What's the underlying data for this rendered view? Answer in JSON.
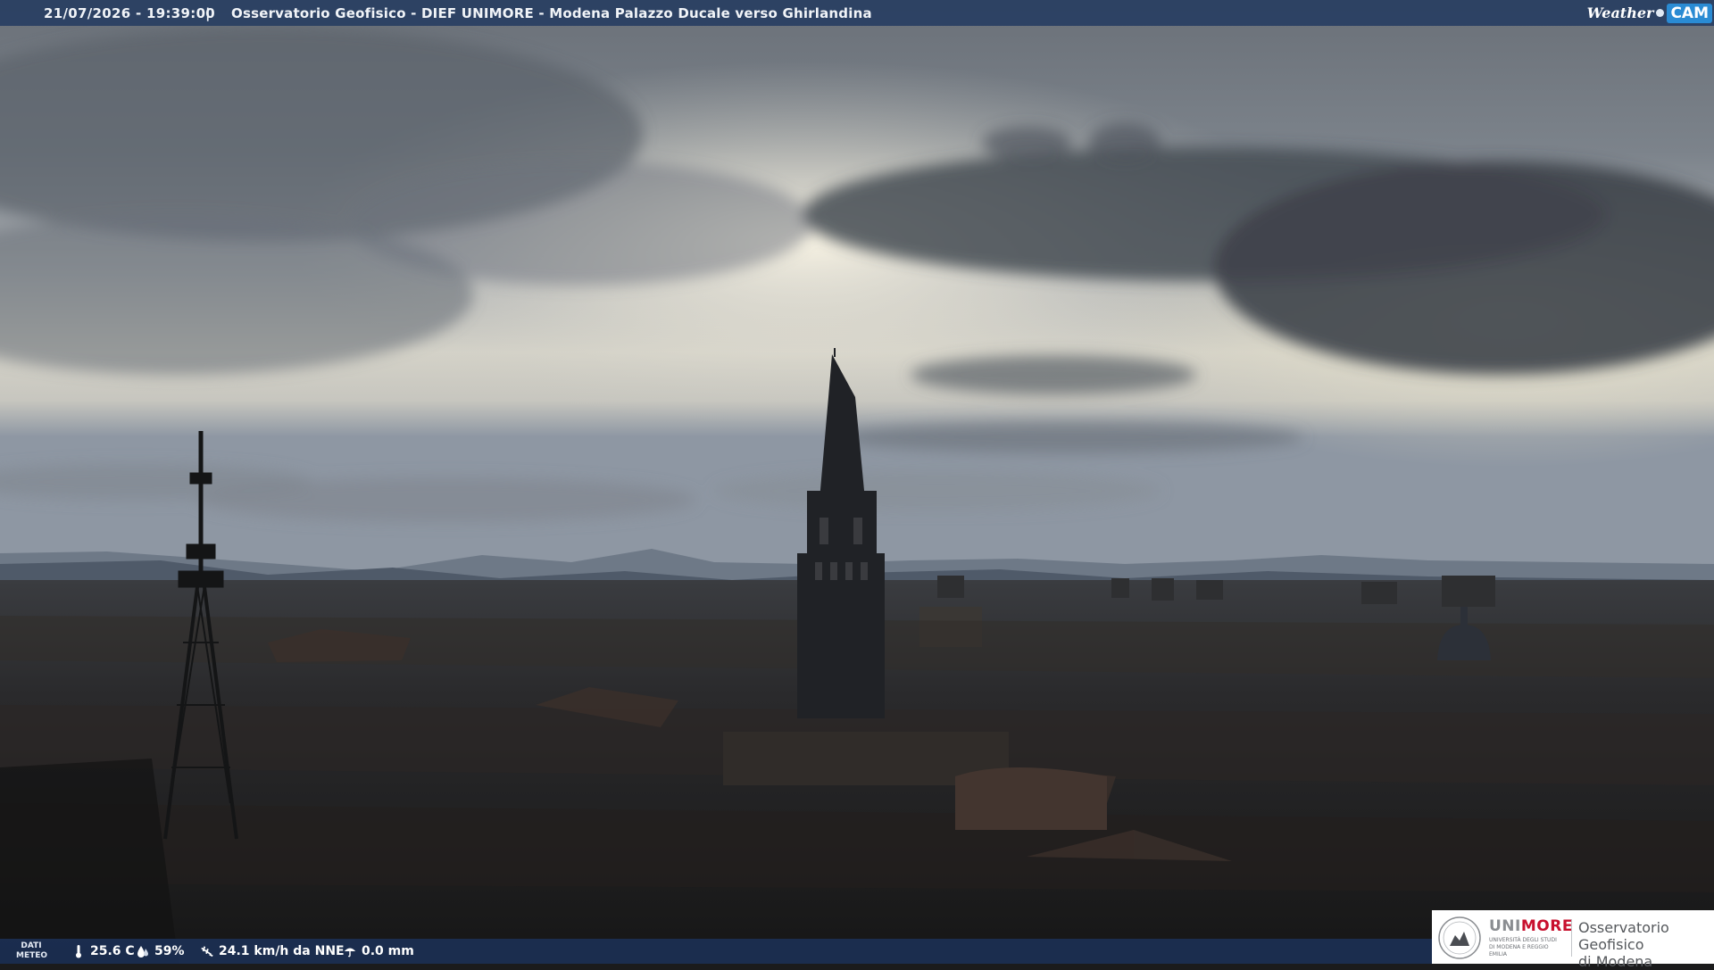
{
  "header": {
    "timestamp": "21/07/2026 - 19:39:00",
    "separator": "|",
    "title": "Osservatorio Geofisico - DIEF UNIMORE - Modena Palazzo Ducale verso Ghirlandina",
    "brand_weather": "Weather",
    "brand_cam": "CAM"
  },
  "weather_bar": {
    "label_line1": "DATI",
    "label_line2": "METEO",
    "temperature": "25.6 C",
    "humidity": "59%",
    "wind": "24.1 km/h da NNE",
    "rain": "0.0 mm",
    "icons": [
      "thermometer-icon",
      "humidity-drop-icon",
      "wind-icon",
      "rain-umbrella-icon"
    ]
  },
  "logo": {
    "uni_part1": "UNI",
    "uni_part2": "MORE",
    "uni_sub": "UNIVERSITÀ DEGLI STUDI DI MODENA E REGGIO EMILIA",
    "obs_line1": "Osservatorio Geofisico",
    "obs_line2": "di Modena"
  },
  "colors": {
    "bar_blue": "#283e62",
    "unimore_red": "#c8102e",
    "brand_cam_blue": "#2a8bd3"
  }
}
